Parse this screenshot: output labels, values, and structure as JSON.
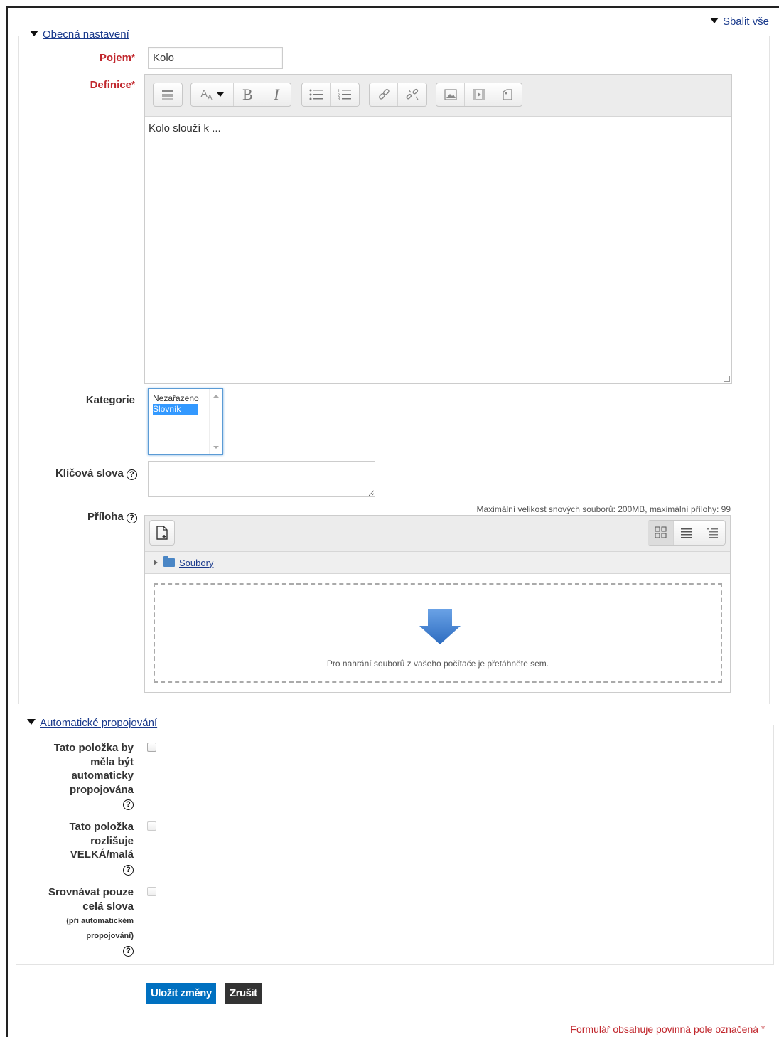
{
  "header": {
    "collapse_all": "Sbalit vše"
  },
  "general": {
    "legend": "Obecná nastavení",
    "concept": {
      "label": "Pojem",
      "value": "Kolo"
    },
    "definition": {
      "label": "Definice",
      "text": "Kolo slouží k ..."
    },
    "category": {
      "label": "Kategorie",
      "options": [
        "Nezařazeno",
        "Slovník"
      ],
      "selected": "Slovník"
    },
    "keywords": {
      "label": "Klíčová slova"
    },
    "attachment": {
      "label": "Příloha",
      "max_size": "Maximální velikost snových souborů: 200MB, maximální přílohy: 99",
      "folder": "Soubory",
      "drop_text": "Pro nahrání souborů z vašeho počítače je přetáhněte sem."
    }
  },
  "autolink": {
    "legend": "Automatické propojování",
    "items": [
      {
        "label": "Tato položka by měla být automaticky propojována",
        "checked": false,
        "disabled": false
      },
      {
        "label": "Tato položka rozlišuje VELKÁ/malá",
        "checked": false,
        "disabled": true
      },
      {
        "label": "Srovnávat pouze celá slova",
        "sublabel": "(při automatickém propojování)",
        "checked": false,
        "disabled": true
      }
    ]
  },
  "actions": {
    "save": "Uložit změny",
    "cancel": "Zrušit"
  },
  "required_note": "Formulář obsahuje povinná pole označená",
  "colors": {
    "required": "#c1272d",
    "primary_button": "#0070c0",
    "cancel_button": "#333333",
    "link": "#1a3a8c"
  },
  "icons": {
    "toolbar": [
      "toggle-toolbar-icon",
      "font-style-icon",
      "bold-icon",
      "italic-icon",
      "bullet-list-icon",
      "numbered-list-icon",
      "link-icon",
      "unlink-icon",
      "image-icon",
      "media-icon",
      "manage-files-icon"
    ],
    "file_manager": [
      "add-file-icon",
      "icon-view-icon",
      "list-view-icon",
      "tree-view-icon"
    ]
  }
}
